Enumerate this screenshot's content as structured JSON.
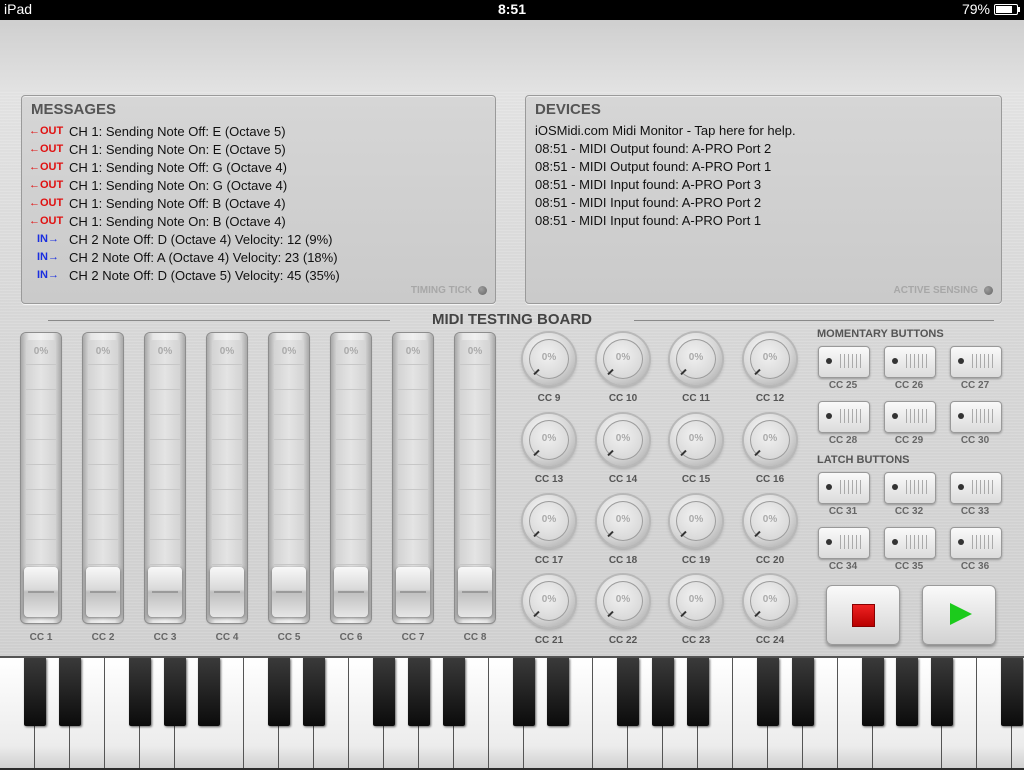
{
  "status_bar": {
    "device": "iPad",
    "time": "8:51",
    "battery": "79%",
    "battery_level": 0.79
  },
  "messages_panel": {
    "title": "MESSAGES",
    "items": [
      {
        "direction": "out",
        "tag": "←OUT",
        "text": "CH 1: Sending Note Off: E (Octave 5)"
      },
      {
        "direction": "out",
        "tag": "←OUT",
        "text": "CH 1: Sending Note On: E (Octave 5)"
      },
      {
        "direction": "out",
        "tag": "←OUT",
        "text": "CH 1: Sending Note Off: G (Octave 4)"
      },
      {
        "direction": "out",
        "tag": "←OUT",
        "text": "CH 1: Sending Note On: G (Octave 4)"
      },
      {
        "direction": "out",
        "tag": "←OUT",
        "text": "CH 1: Sending Note Off: B (Octave 4)"
      },
      {
        "direction": "out",
        "tag": "←OUT",
        "text": "CH 1: Sending Note On: B (Octave 4)"
      },
      {
        "direction": "in",
        "tag": "IN→",
        "text": "CH 2 Note Off: D (Octave 4) Velocity: 12 (9%)"
      },
      {
        "direction": "in",
        "tag": "IN→",
        "text": "CH 2 Note Off: A (Octave 4) Velocity: 23 (18%)"
      },
      {
        "direction": "in",
        "tag": "IN→",
        "text": "CH 2 Note Off: D (Octave 5) Velocity: 45 (35%)"
      }
    ],
    "indicator": "TIMING TICK"
  },
  "devices_panel": {
    "title": "DEVICES",
    "items": [
      "iOSMidi.com Midi Monitor - Tap here for help.",
      "08:51 - MIDI Output found: A-PRO Port 2",
      "08:51 - MIDI Output found: A-PRO Port 1",
      "08:51 - MIDI Input found: A-PRO Port 3",
      "08:51 - MIDI Input found: A-PRO Port 2",
      "08:51 - MIDI Input found: A-PRO Port 1"
    ],
    "indicator": "ACTIVE SENSING"
  },
  "board": {
    "title": "MIDI TESTING BOARD",
    "sliders": [
      {
        "label": "CC 1",
        "value": "0%"
      },
      {
        "label": "CC 2",
        "value": "0%"
      },
      {
        "label": "CC 3",
        "value": "0%"
      },
      {
        "label": "CC 4",
        "value": "0%"
      },
      {
        "label": "CC 5",
        "value": "0%"
      },
      {
        "label": "CC 6",
        "value": "0%"
      },
      {
        "label": "CC 7",
        "value": "0%"
      },
      {
        "label": "CC 8",
        "value": "0%"
      }
    ],
    "knobs": [
      {
        "label": "CC 9",
        "value": "0%"
      },
      {
        "label": "CC 10",
        "value": "0%"
      },
      {
        "label": "CC 11",
        "value": "0%"
      },
      {
        "label": "CC 12",
        "value": "0%"
      },
      {
        "label": "CC 13",
        "value": "0%"
      },
      {
        "label": "CC 14",
        "value": "0%"
      },
      {
        "label": "CC 15",
        "value": "0%"
      },
      {
        "label": "CC 16",
        "value": "0%"
      },
      {
        "label": "CC 17",
        "value": "0%"
      },
      {
        "label": "CC 18",
        "value": "0%"
      },
      {
        "label": "CC 19",
        "value": "0%"
      },
      {
        "label": "CC 20",
        "value": "0%"
      },
      {
        "label": "CC 21",
        "value": "0%"
      },
      {
        "label": "CC 22",
        "value": "0%"
      },
      {
        "label": "CC 23",
        "value": "0%"
      },
      {
        "label": "CC 24",
        "value": "0%"
      }
    ],
    "momentary_title": "MOMENTARY BUTTONS",
    "momentary_buttons": [
      "CC 25",
      "CC 26",
      "CC 27",
      "CC 28",
      "CC 29",
      "CC 30"
    ],
    "latch_title": "LATCH BUTTONS",
    "latch_buttons": [
      "CC 31",
      "CC 32",
      "CC 33",
      "CC 34",
      "CC 35",
      "CC 36"
    ],
    "transport": {
      "stop_icon": "stop-icon",
      "play_icon": "play-icon"
    }
  },
  "colors": {
    "out_tag": "#e01010",
    "in_tag": "#1a2ee0",
    "stop": "#d61010",
    "play": "#1ccb1c"
  }
}
